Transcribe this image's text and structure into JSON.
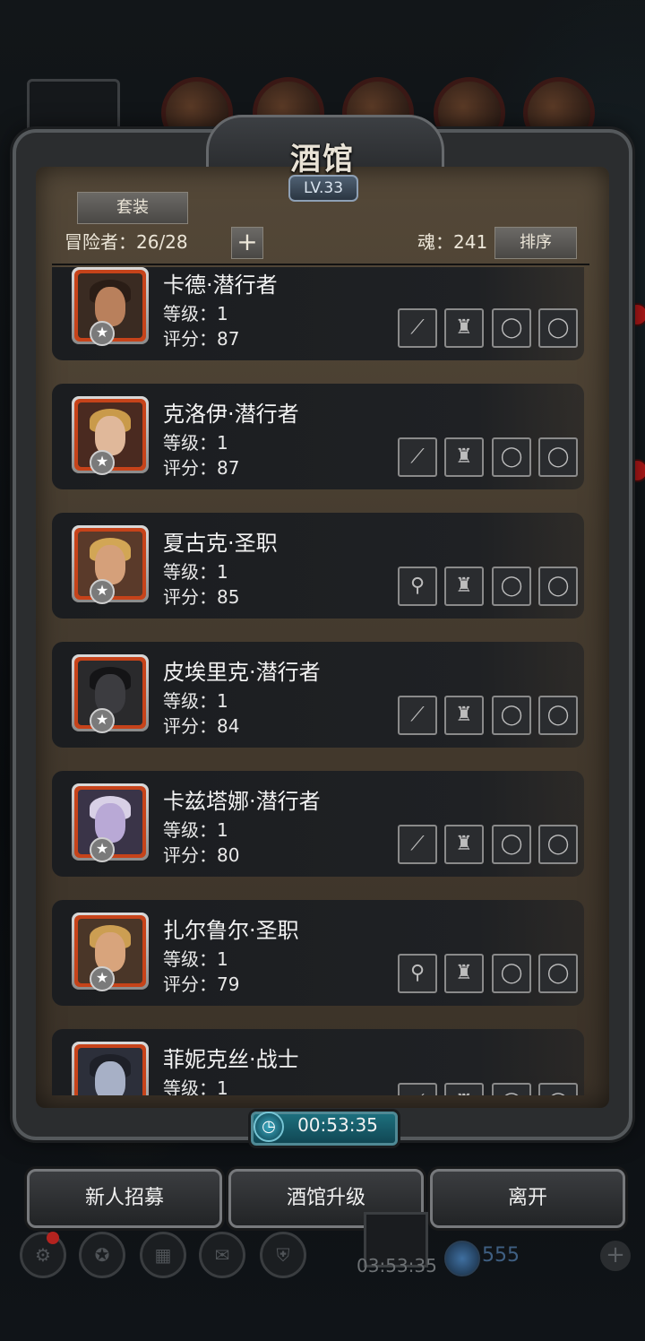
{
  "title": "酒馆",
  "level_badge": "LV.33",
  "tab_set": "套装",
  "adventurer_count": "冒险者：26/28",
  "soul_count": "魂：241",
  "sort_button": "排序",
  "heroes": [
    {
      "name": "卡德·潜行者",
      "level": "等级：1",
      "score": "评分：87",
      "weapon_icon": "dagger-icon"
    },
    {
      "name": "克洛伊·潜行者",
      "level": "等级：1",
      "score": "评分：87",
      "weapon_icon": "dagger-icon"
    },
    {
      "name": "夏古克·圣职",
      "level": "等级：1",
      "score": "评分：85",
      "weapon_icon": "mace-icon"
    },
    {
      "name": "皮埃里克·潜行者",
      "level": "等级：1",
      "score": "评分：84",
      "weapon_icon": "dagger-icon"
    },
    {
      "name": "卡兹塔娜·潜行者",
      "level": "等级：1",
      "score": "评分：80",
      "weapon_icon": "dagger-icon"
    },
    {
      "name": "扎尔鲁尔·圣职",
      "level": "等级：1",
      "score": "评分：79",
      "weapon_icon": "mace-icon"
    },
    {
      "name": "菲妮克丝·战士",
      "level": "等级：1",
      "score": "",
      "weapon_icon": "sword-icon"
    }
  ],
  "timer": "00:53:35",
  "buttons": {
    "recruit": "新人招募",
    "upgrade": "酒馆升级",
    "leave": "离开"
  },
  "background_hud": {
    "timer": "03:53:35",
    "gem_count": "555"
  },
  "colors": {
    "avatar_border": "#c6431a",
    "timer_bar": "#1d6f7d",
    "parchment": "#4a3f32"
  }
}
